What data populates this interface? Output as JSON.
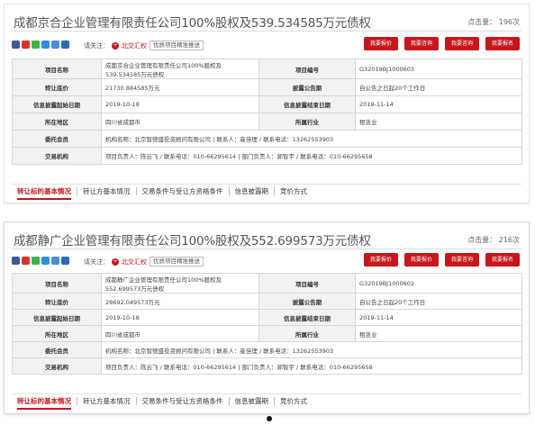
{
  "colors": {
    "accent": "#c8161d",
    "label_bg": "#f2f2f2"
  },
  "share_icons": [
    {
      "name": "weibo-icon",
      "color": "#3b5998"
    },
    {
      "name": "qzone-icon",
      "color": "#d9302b"
    },
    {
      "name": "wechat-icon",
      "color": "#3bb54a"
    },
    {
      "name": "tencent-weibo-icon",
      "color": "#2a8fd8"
    },
    {
      "name": "email-icon",
      "color": "#4a8bd6"
    },
    {
      "name": "renren-icon",
      "color": "#2c6ab8"
    }
  ],
  "listings": [
    {
      "title": "成都京合企业管理有限责任公司100%股权及539.534585万元债权",
      "views": "点击量： 196次",
      "follow_label": "请关注：",
      "follow_button": "北交汇权",
      "tag": "优质项目精准推送",
      "actions": [
        "我要报价",
        "我要咨询",
        "我要咨询",
        "我要报名"
      ],
      "rows": [
        [
          "项目名称",
          "成都京合企业管理有限责任公司100%股权及539.534585万元债权",
          "项目编号",
          "G32019BJ1000603"
        ],
        [
          "转让底价",
          "21730.884585万元",
          "披露公告期",
          "自公告之日起20个工作日"
        ],
        [
          "信息披露起始日期",
          "2019-10-18",
          "信息披露结束日期",
          "2019-11-14"
        ],
        [
          "所在地区",
          "四川省成都市",
          "所属行业",
          "租赁业"
        ],
        [
          "委托会员",
          "机构名称：北京智德盛投资顾问有限公司 | 联系人：崔佳理 / 联系电话：13262553903"
        ],
        [
          "交易机构",
          "项目负责人：陈云飞 / 联系电话：010-66295614 | 部门负责人：郭智宇 / 联系电话：010-66295658"
        ]
      ],
      "tabs": [
        "转让标的基本情况",
        "转让方基本情况",
        "交易条件与受让方资格条件",
        "信息披露期",
        "竞价方式"
      ]
    },
    {
      "title": "成都静广企业管理有限责任公司100%股权及552.699573万元债权",
      "views": "点击量： 216次",
      "follow_label": "请关注：",
      "follow_button": "北交汇权",
      "tag": "优质项目精准推送",
      "actions": [
        "我要报价",
        "我要报价",
        "我要咨询",
        "我要报名"
      ],
      "rows": [
        [
          "项目名称",
          "成都静广企业管理有限责任公司100%股权及 552.699573万元债权",
          "项目编号",
          "G32019BJ1000602"
        ],
        [
          "转让底价",
          "28692.049573万元",
          "披露公告期",
          "自公告之日起20个工作日"
        ],
        [
          "信息披露起始日期",
          "2019-10-18",
          "信息披露结束日期",
          "2019-11-14"
        ],
        [
          "所在地区",
          "四川省成都市",
          "所属行业",
          "租赁业"
        ],
        [
          "委托会员",
          "机构名称：北京智德盛投资顾问有限公司 | 联系人：崔佳理 / 联系电话：13262553903"
        ],
        [
          "交易机构",
          "项目负责人：陈云飞 / 联系电话：010-66295614 | 部门负责人：郭智宇 / 联系电话：010-66295658"
        ]
      ],
      "tabs": [
        "转让标的基本情况",
        "转让方基本情况",
        "交易条件与受让方资格条件",
        "信息披露期",
        "竞价方式"
      ]
    }
  ]
}
